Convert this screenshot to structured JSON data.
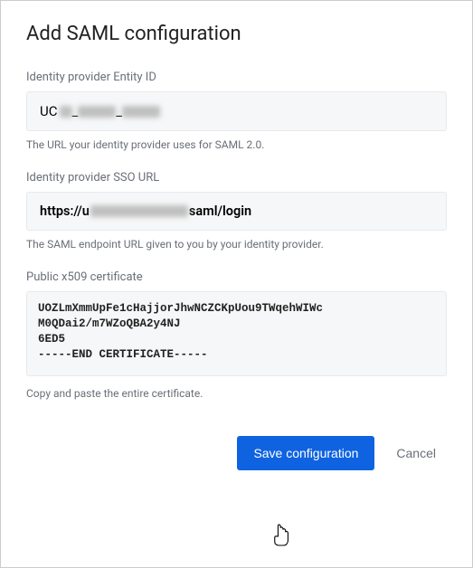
{
  "heading": "Add SAML configuration",
  "entity": {
    "label": "Identity provider Entity ID",
    "value_prefix": "UC",
    "helper": "The URL your identity provider uses for SAML 2.0."
  },
  "sso": {
    "label": "Identity provider SSO URL",
    "value_prefix": "https://u",
    "value_suffix": "saml/login",
    "helper": "The SAML endpoint URL given to you by your identity provider."
  },
  "cert": {
    "label": "Public x509 certificate",
    "value": "UOZLmXmmUpFe1cHajjorJhwNCZCKpUou9TWqehWIWc\nM0QDai2/m7WZoQBA2y4NJ\n6ED5\n-----END CERTIFICATE-----",
    "helper": "Copy and paste the entire certificate."
  },
  "buttons": {
    "save": "Save configuration",
    "cancel": "Cancel"
  }
}
